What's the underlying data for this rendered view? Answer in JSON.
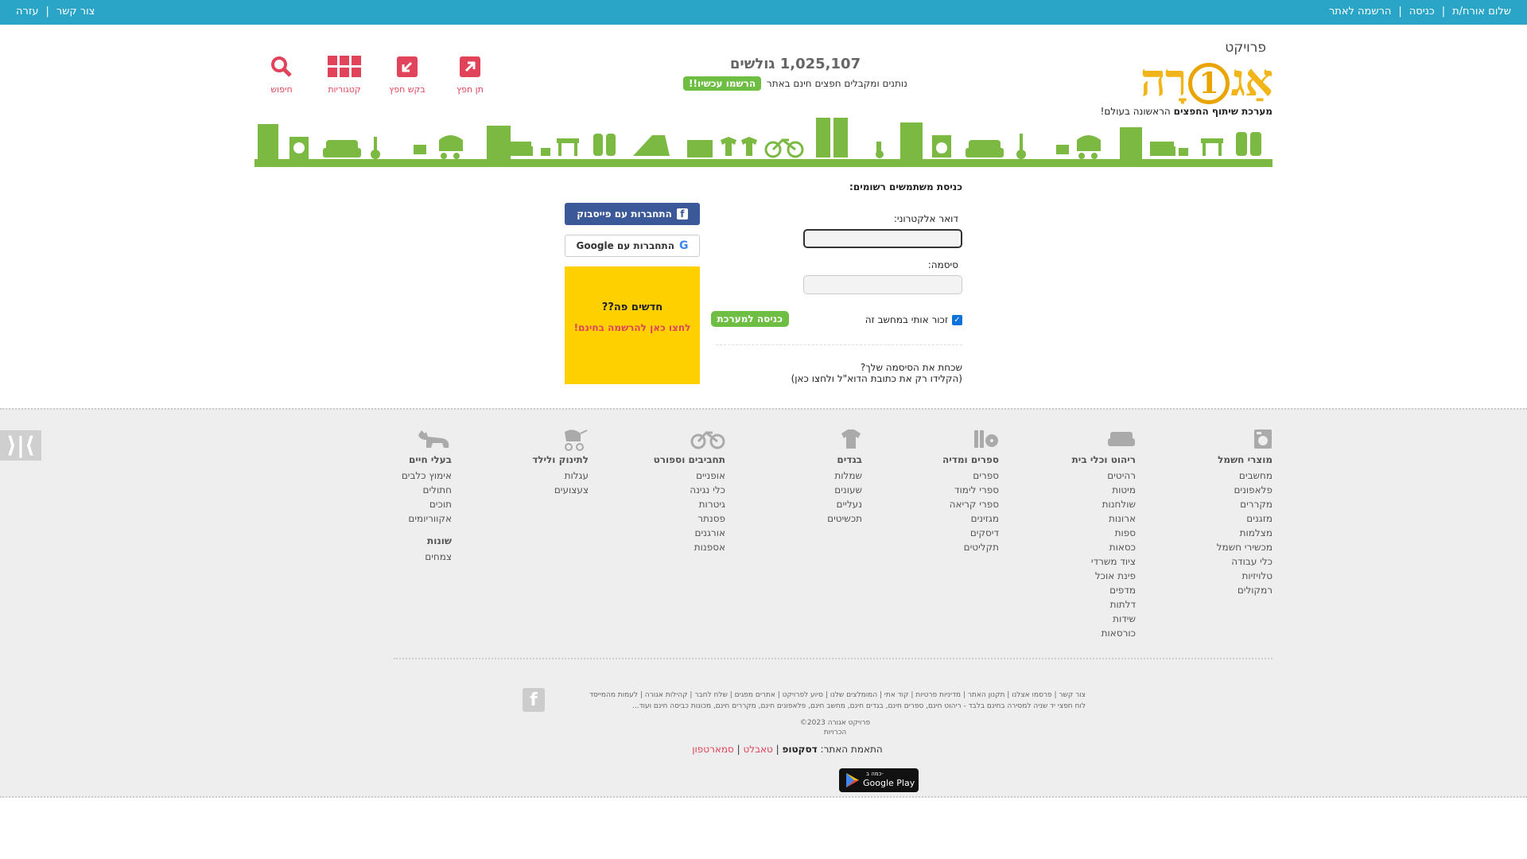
{
  "topbar": {
    "right_links": [
      "שלום אורח/ת",
      "כניסה",
      "הרשמה לאתר"
    ],
    "left_links": [
      "צור קשר",
      "עזרה"
    ]
  },
  "logo": {
    "top_word": "פרויקט",
    "main_before": "אַג",
    "main_digit": "1",
    "main_after": "רָה",
    "tagline_bold": "מערכת שיתוף החפצים",
    "tagline_rest": " הראשונה בעולם!"
  },
  "counter": {
    "number": "1,025,107",
    "unit": "גולשים",
    "subtitle": "נותנים ומקבלים חפצים חינם באתר",
    "register_label": "הרשמו עכשיו!!"
  },
  "iconnav": [
    {
      "label": "תן חפץ",
      "icon": "give-item-icon"
    },
    {
      "label": "בקש חפץ",
      "icon": "request-item-icon"
    },
    {
      "label": "קטגוריות",
      "icon": "categories-icon"
    },
    {
      "label": "חיפוש",
      "icon": "search-icon"
    }
  ],
  "login": {
    "title": "כניסת משתמשים רשומים:",
    "email_label": "דואר אלקטרוני:",
    "email_value": "",
    "password_label": "סיסמה:",
    "password_value": "",
    "remember_label": "זכור אותי במחשב זה",
    "remember_checked": true,
    "submit_label": "כניסה למערכת",
    "forgot_line1": "שכחת את הסיסמה שלך?",
    "forgot_line2": "(הקלידו רק את כתובת הדוא\"ל ולחצו כאן)"
  },
  "social": {
    "facebook_label": "התחברות עם פייסבוק",
    "google_label": "התחברות עם",
    "google_brand": "Google",
    "new_title": "חדשים פה??",
    "new_cta": "לחצו כאן להרשמה בחינם!"
  },
  "categories": [
    {
      "title": "מוצרי חשמל",
      "icon": "appliance-icon",
      "items": [
        "מחשבים",
        "פלאפונים",
        "מקררים",
        "מזגנים",
        "מצלמות",
        "מכשירי חשמל",
        "כלי עבודה",
        "טלויזיות",
        "רמקולים"
      ]
    },
    {
      "title": "ריהוט וכלי בית",
      "icon": "sofa-icon",
      "items": [
        "רהיטים",
        "מיטות",
        "שולחנות",
        "ארונות",
        "ספות",
        "כסאות",
        "ציוד משרדי",
        "פינת אוכל",
        "מדפים",
        "דלתות",
        "שידות",
        "כורסאות"
      ]
    },
    {
      "title": "ספרים ומדיה",
      "icon": "books-media-icon",
      "items": [
        "ספרים",
        "ספרי לימוד",
        "ספרי קריאה",
        "מגזינים",
        "דיסקים",
        "תקליטים"
      ]
    },
    {
      "title": "בגדים",
      "icon": "shirt-icon",
      "items": [
        "שמלות",
        "שעונים",
        "נעליים",
        "תכשיטים"
      ]
    },
    {
      "title": "תחביבים וספורט",
      "icon": "bicycle-icon",
      "items": [
        "אופניים",
        "כלי נגינה",
        "גיטרות",
        "פסנתר",
        "אורגנים",
        "אספנות"
      ]
    },
    {
      "title": "לתינוק ולילד",
      "icon": "stroller-icon",
      "items": [
        "עגלות",
        "צעצועים"
      ]
    },
    {
      "title": "בעלי חיים",
      "icon": "pet-icon",
      "items": [
        "אימוץ כלבים",
        "חתולים",
        "תוכים",
        "אקווריומים"
      ],
      "sub_title": "שונות",
      "sub_items": [
        "צמחים"
      ]
    }
  ],
  "footer": {
    "links": [
      "צור קשר",
      "פרסמו אצלנו",
      "תקנון האתר",
      "מדיניות פרטיות",
      "קוד אתי",
      "המומלצים שלנו",
      "סיוע לפרויקט",
      "אתרים מפגים",
      "שלח לחבר",
      "קהילות אגורה",
      "לעמות מהמייסד"
    ],
    "description": "לוח חפצי יד שניה למסירה בחינם בלבד - ריהוט חינם, ספרים חינם, בגדים חינם, מחשב חינם, פלאפונים חינם, מקררים חינם, מכונות כביסה חינם ועוד...",
    "copyright": "©2023 פרויקט אגורה",
    "credits": "הכרויות",
    "adapt_label": "התאמת האתר:",
    "adapt_current": "דסקטופ",
    "adapt_options": [
      "טאבלט",
      "סמארטפון"
    ],
    "gplay_small": "כמה ב-",
    "gplay_big": "Google Play",
    "side_button": "⟩|⟨"
  },
  "colors": {
    "topbar": "#2aa5c8",
    "accent_green": "#6fbe44",
    "banner_green": "#7cb942",
    "nav_red": "#e0435a",
    "facebook": "#3b5998",
    "promo_yellow": "#ffd000",
    "footer_bg": "#eeeeee"
  }
}
